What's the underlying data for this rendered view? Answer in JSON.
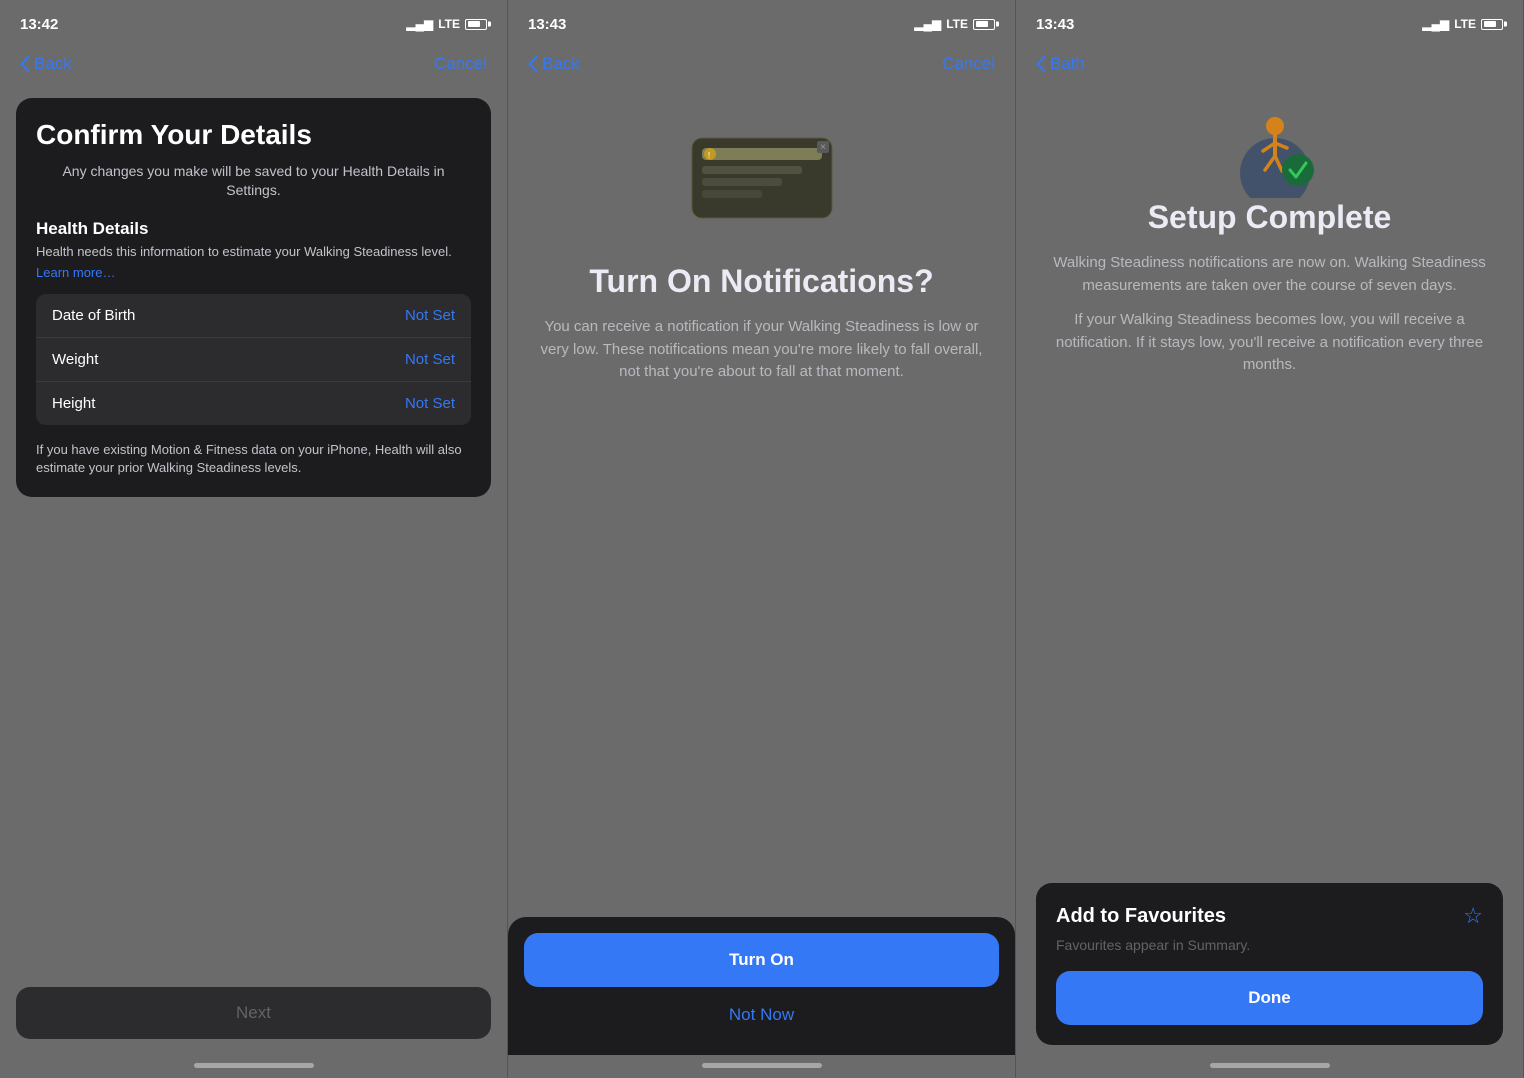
{
  "screen1": {
    "status_time": "13:42",
    "nav_back": "Back",
    "nav_cancel": "Cancel",
    "title": "Confirm Your Details",
    "subtitle": "Any changes you make will be saved to your Health Details in Settings.",
    "section_heading": "Health Details",
    "section_desc": "Health needs this information to estimate your Walking Steadiness level.",
    "learn_more": "Learn more…",
    "rows": [
      {
        "label": "Date of Birth",
        "value": "Not Set"
      },
      {
        "label": "Weight",
        "value": "Not Set"
      },
      {
        "label": "Height",
        "value": "Not Set"
      }
    ],
    "footer": "If you have existing Motion & Fitness data on your iPhone, Health will also estimate your prior Walking Steadiness levels.",
    "next_btn": "Next"
  },
  "screen2": {
    "status_time": "13:43",
    "nav_back": "Back",
    "nav_cancel": "Cancel",
    "title": "Turn On Notifications?",
    "body": "You can receive a notification if your Walking Steadiness is low or very low. These notifications mean you're more likely to fall overall, not that you're about to fall at that moment.",
    "turn_on": "Turn On",
    "not_now": "Not Now"
  },
  "screen3": {
    "status_time": "13:43",
    "nav_back": "Bath",
    "title": "Setup Complete",
    "body1": "Walking Steadiness notifications are now on. Walking Steadiness measurements are taken over the course of seven days.",
    "body2": "If your Walking Steadiness becomes low, you will receive a notification. If it stays low, you'll receive a notification every three months.",
    "add_to_favourites": "Add to Favourites",
    "fav_subtitle": "Favourites appear in Summary.",
    "done_btn": "Done"
  }
}
